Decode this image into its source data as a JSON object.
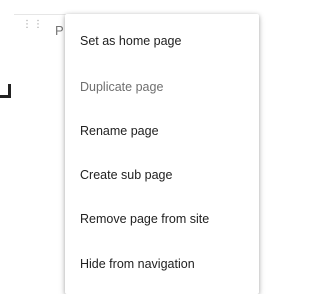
{
  "page_row": {
    "drag_icon": "drag-handle-icon",
    "visible_label": "P"
  },
  "context_menu": {
    "items": [
      {
        "label": "Set as home page",
        "enabled": true
      },
      {
        "label": "Duplicate page",
        "enabled": false
      },
      {
        "label": "Rename page",
        "enabled": true
      },
      {
        "label": "Create sub page",
        "enabled": true
      },
      {
        "label": "Remove page from site",
        "enabled": true
      },
      {
        "label": "Hide from navigation",
        "enabled": true
      }
    ]
  }
}
